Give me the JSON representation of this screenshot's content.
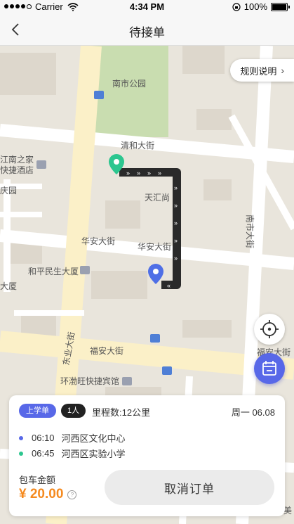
{
  "status_bar": {
    "carrier": "Carrier",
    "time": "4:34 PM",
    "battery": "100%"
  },
  "nav": {
    "title": "待接单"
  },
  "map": {
    "labels": {
      "park": "南市公园",
      "qinghe": "清和大街",
      "jiangnan_1": "江南之家",
      "jiangnan_2": "快捷酒店",
      "qingyuan": "庆园",
      "tianhui": "天汇尚",
      "huaan_1": "华安大街",
      "huaan_2": "华安大街",
      "heping": "和平民生大厦",
      "dasha": "大厦",
      "nanshi_ave": "南市大街",
      "dongye": "东业大街",
      "fuan_1": "福安大街",
      "fuan_2": "福安大街",
      "hotel": "环渤旺快捷宾馆",
      "corner": "美"
    }
  },
  "rules_button": {
    "label": "规则说明"
  },
  "order": {
    "tag_type": "上学单",
    "tag_people": "1人",
    "mileage": "里程数:12公里",
    "date": "周一 06.08",
    "stops": [
      {
        "time": "06:10",
        "place": "河西区文化中心",
        "color": "#5868e8"
      },
      {
        "time": "06:45",
        "place": "河西区实验小学",
        "color": "#2cc68f"
      }
    ],
    "amount_label": "包车金额",
    "amount": "¥ 20.00",
    "cancel_label": "取消订单"
  },
  "colors": {
    "accent": "#5868e8",
    "price": "#f58a1f",
    "start_pin": "#2cc68f"
  }
}
